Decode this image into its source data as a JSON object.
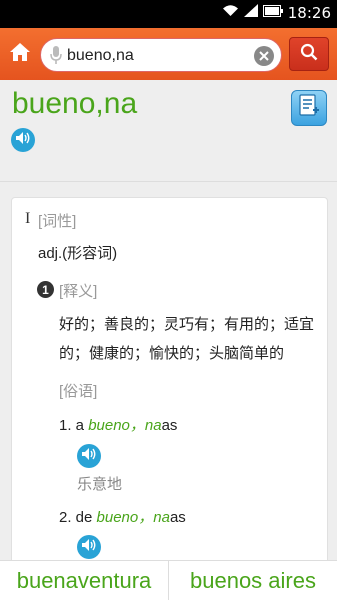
{
  "status_bar": {
    "time": "18:26"
  },
  "search": {
    "value": "bueno,na"
  },
  "entry": {
    "headword": "bueno,na",
    "roman_numeral": "I",
    "pos_tag": "[词性]",
    "pos_text": "adj.(形容词)",
    "sense_number": "1",
    "def_tag": "[释义]",
    "definition": "好的；善良的；灵巧有；有用的；适宜的；健康的；愉快的；头脑简单的",
    "idiom_tag": "[俗语]",
    "idioms": [
      {
        "prefix": "1. a ",
        "highlight": "bueno，na",
        "suffix": "as",
        "meaning": "乐意地"
      },
      {
        "prefix": "2. de ",
        "highlight": "bueno，na",
        "suffix": "as"
      }
    ]
  },
  "bottom_nav": {
    "prev_word": "buenaventura",
    "next_word": "buenos aires"
  },
  "colors": {
    "accent_green": "#4aa51b",
    "toolbar_orange": "#f36f2f",
    "speaker_blue": "#29a3d6"
  }
}
